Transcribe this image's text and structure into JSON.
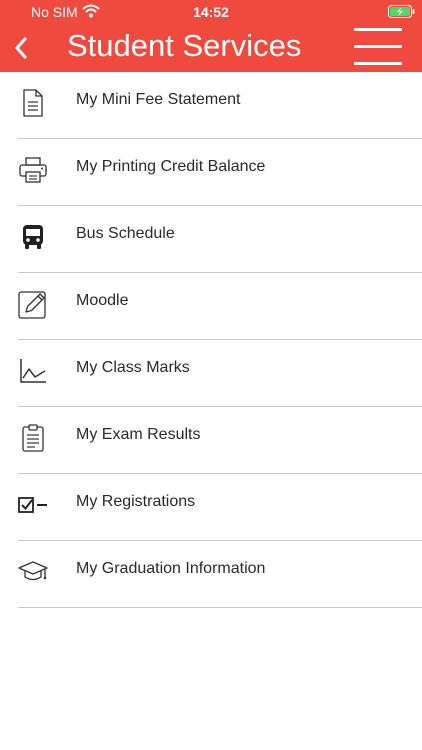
{
  "status_bar": {
    "carrier": "No SIM",
    "time": "14:52"
  },
  "header": {
    "title": "Student Services",
    "background_color": "#f0493d",
    "back_icon": "chevron-left-icon",
    "menu_icon": "hamburger-menu-icon"
  },
  "items": [
    {
      "label": "My Mini Fee Statement",
      "icon": "document-icon"
    },
    {
      "label": "My Printing Credit Balance",
      "icon": "printer-icon"
    },
    {
      "label": "Bus Schedule",
      "icon": "bus-icon"
    },
    {
      "label": "Moodle",
      "icon": "pencil-edit-icon"
    },
    {
      "label": "My Class Marks",
      "icon": "line-chart-icon"
    },
    {
      "label": "My Exam Results",
      "icon": "clipboard-icon"
    },
    {
      "label": "My Registrations",
      "icon": "checkbox-list-icon"
    },
    {
      "label": "My Graduation Information",
      "icon": "graduation-cap-icon"
    }
  ]
}
